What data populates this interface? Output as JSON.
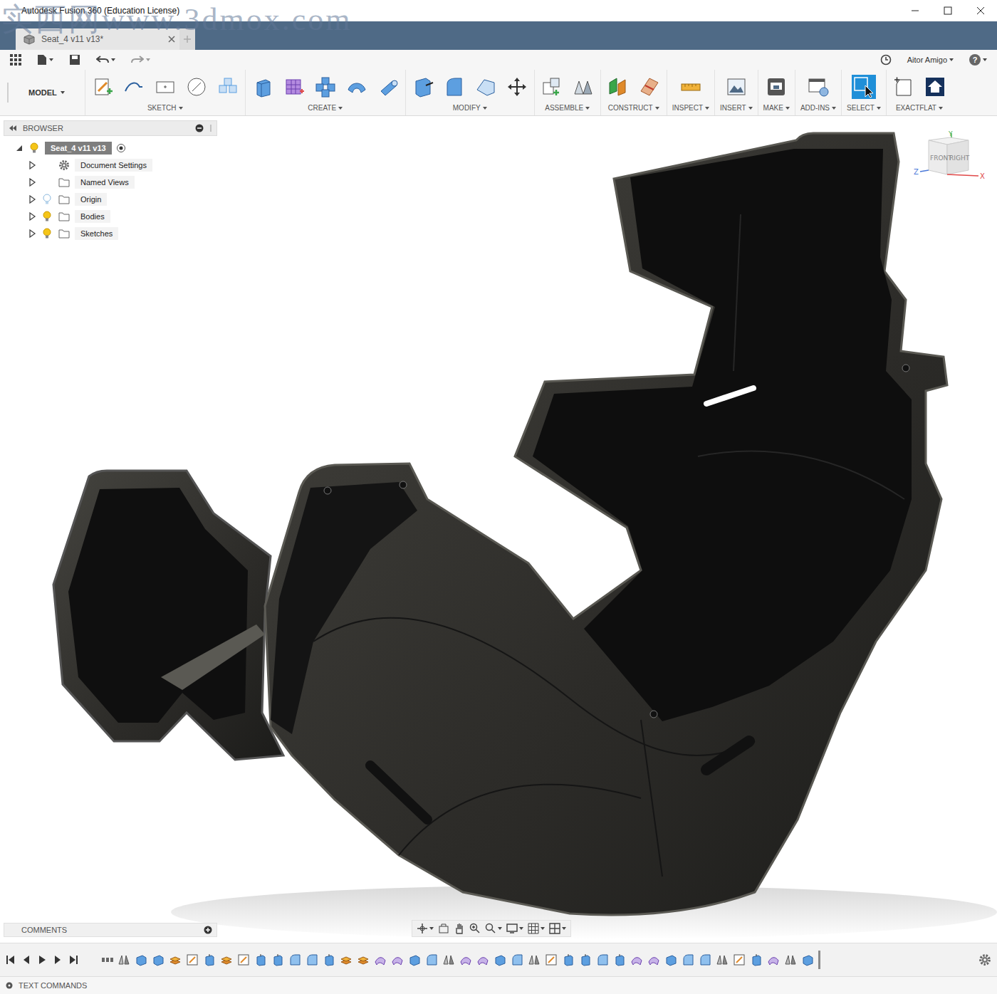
{
  "window": {
    "title": "Autodesk Fusion 360 (Education License)",
    "watermark": "实西网www.3dmox.com"
  },
  "document_tab": {
    "label": "Seat_4 v11 v13*",
    "selected": true
  },
  "user": {
    "name": "Aitor Amigo",
    "help": "?"
  },
  "workspace": {
    "label": "MODEL"
  },
  "toolbar": [
    {
      "label": "SKETCH",
      "active": false,
      "icons": [
        "create-sketch",
        "line",
        "rectangle",
        "circle",
        "project"
      ]
    },
    {
      "label": "CREATE",
      "active": false,
      "icons": [
        "extrude",
        "form",
        "pattern",
        "sweep",
        "pipe"
      ]
    },
    {
      "label": "MODIFY",
      "active": false,
      "icons": [
        "press-pull",
        "fillet",
        "chamfer",
        "move"
      ]
    },
    {
      "label": "ASSEMBLE",
      "active": false,
      "icons": [
        "new-component",
        "joint"
      ]
    },
    {
      "label": "CONSTRUCT",
      "active": false,
      "icons": [
        "offset-plane",
        "plane-angle"
      ]
    },
    {
      "label": "INSPECT",
      "active": false,
      "icons": [
        "measure"
      ]
    },
    {
      "label": "INSERT",
      "active": false,
      "icons": [
        "insert-image"
      ]
    },
    {
      "label": "MAKE",
      "active": false,
      "icons": [
        "make-3d"
      ]
    },
    {
      "label": "ADD-INS",
      "active": false,
      "icons": [
        "scripts"
      ]
    },
    {
      "label": "SELECT",
      "active": true,
      "icons": [
        "select"
      ]
    },
    {
      "label": "EXACTFLAT",
      "active": false,
      "icons": [
        "exactflat-sketch",
        "exactflat-flatten"
      ]
    }
  ],
  "browser": {
    "title": "BROWSER",
    "root": {
      "label": "Seat_4 v11 v13",
      "expanded": true,
      "visible": true,
      "active": true
    },
    "items": [
      {
        "label": "Document Settings",
        "kind": "settings",
        "expanded": false
      },
      {
        "label": "Named Views",
        "kind": "views",
        "expanded": false
      },
      {
        "label": "Origin",
        "kind": "folder",
        "expanded": false,
        "visible": false
      },
      {
        "label": "Bodies",
        "kind": "folder",
        "expanded": false,
        "visible": true
      },
      {
        "label": "Sketches",
        "kind": "folder",
        "expanded": false,
        "visible": true
      }
    ]
  },
  "viewcube": {
    "faces": [
      "FRONT",
      "RIGHT"
    ],
    "axes": [
      {
        "label": "Z",
        "color": "#4a78d8"
      },
      {
        "label": "X",
        "color": "#e04848"
      },
      {
        "label": "Y",
        "color": "#45b04f"
      }
    ]
  },
  "comments": {
    "title": "COMMENTS"
  },
  "timeline": {
    "features": [
      "mirror",
      "box",
      "box",
      "stack",
      "sketch",
      "extrude",
      "stack",
      "sketch",
      "extrude",
      "extrude",
      "fillet",
      "fillet",
      "extrude",
      "stack",
      "stack",
      "surface",
      "surface",
      "box",
      "fillet",
      "mirror",
      "surface",
      "surface",
      "box",
      "fillet",
      "mirror",
      "sketch",
      "extrude",
      "extrude",
      "fillet",
      "extrude",
      "surface",
      "surface",
      "box",
      "fillet",
      "fillet",
      "mirror",
      "sketch",
      "extrude",
      "surface",
      "mirror",
      "box"
    ]
  },
  "text_commands": {
    "title": "TEXT COMMANDS"
  }
}
